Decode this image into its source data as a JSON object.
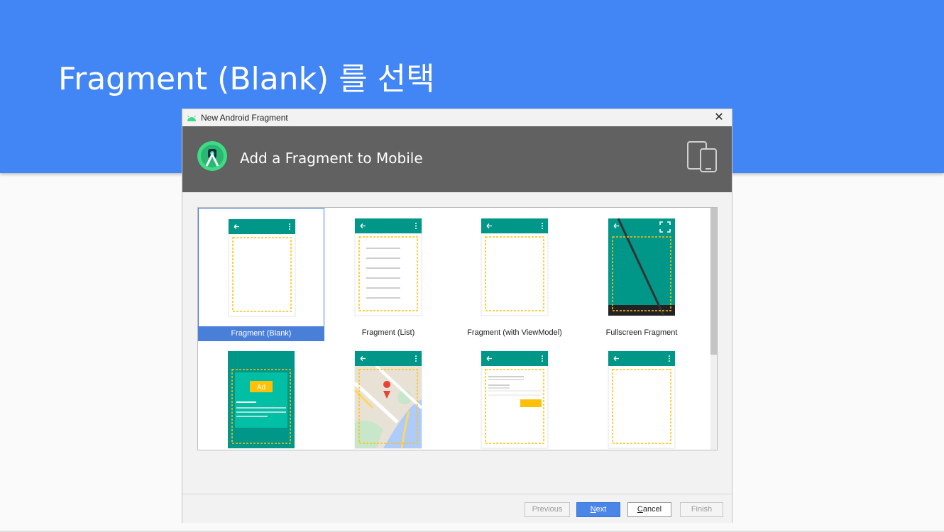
{
  "slide": {
    "title": "Fragment (Blank) 를 선택",
    "header_color": "#4285f4"
  },
  "dialog": {
    "window_title": "New Android Fragment",
    "banner_heading": "Add a Fragment to Mobile",
    "icons": {
      "app": "android-icon",
      "logo": "android-studio-logo-icon",
      "device": "phone-tablet-icon",
      "close": "close-icon"
    },
    "templates": [
      {
        "caption": "Fragment (Blank)",
        "preview": "blank",
        "selected": true
      },
      {
        "caption": "Fragment (List)",
        "preview": "list",
        "selected": false
      },
      {
        "caption": "Fragment (with ViewModel)",
        "preview": "blank",
        "selected": false
      },
      {
        "caption": "Fullscreen Fragment",
        "preview": "fullscreen",
        "selected": false
      },
      {
        "caption": "",
        "preview": "ad",
        "selected": false
      },
      {
        "caption": "",
        "preview": "map",
        "selected": false
      },
      {
        "caption": "",
        "preview": "login",
        "selected": false
      },
      {
        "caption": "",
        "preview": "blank",
        "selected": false
      }
    ],
    "ad_label": "Ad",
    "buttons": {
      "previous": "Previous",
      "next": "Next",
      "cancel": "Cancel",
      "finish": "Finish"
    },
    "colors": {
      "accent": "#4a86e8",
      "teal": "#009688",
      "placeholder_outline": "#ffc107"
    }
  }
}
